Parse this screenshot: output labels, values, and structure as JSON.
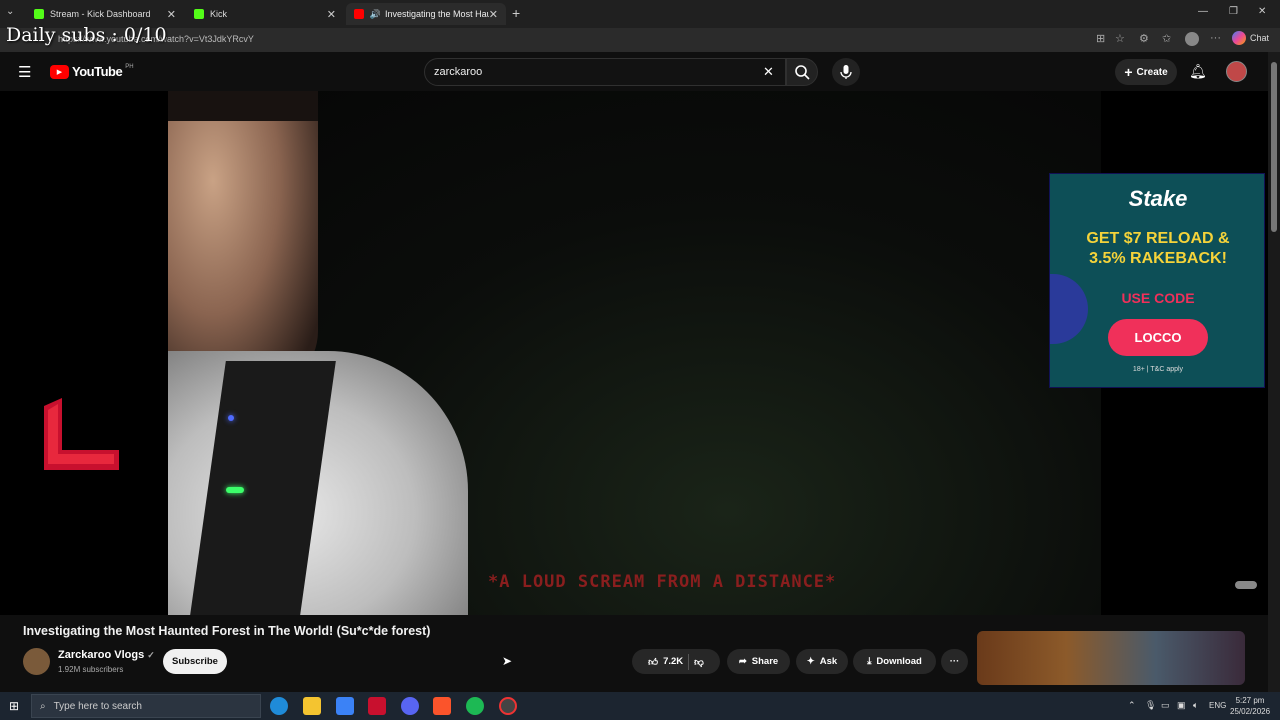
{
  "overlay": {
    "text": "Daily subs : 0/10"
  },
  "browser": {
    "tabs": [
      {
        "label": "Stream - Kick Dashboard",
        "favicon_color": "#53fc18"
      },
      {
        "label": "Kick",
        "favicon_color": "#53fc18"
      },
      {
        "label": "Investigating the Most Haunte",
        "favicon_color": "#ff0000"
      }
    ],
    "url": "https://www.youtube.com/watch?v=Vt3JdkYRcvY",
    "chat_label": "Chat"
  },
  "youtube": {
    "logo_text": "YouTube",
    "region": "PH",
    "search_value": "zarckaroo",
    "create_label": "Create"
  },
  "video": {
    "caption": "*A LOUD SCREAM FROM A DISTANCE*",
    "ad": {
      "brand": "Stake",
      "headline_line1": "GET $7 RELOAD &",
      "headline_line2": "3.5% RAKEBACK!",
      "use_code": "USE CODE",
      "code": "LOCCO",
      "disclaimer": "18+ | T&C apply"
    }
  },
  "info": {
    "title": "Investigating the Most Haunted Forest in The World! (Su*c*de forest)",
    "channel": "Zarckaroo Vlogs",
    "subscribers": "1.92M subscribers",
    "subscribe_label": "Subscribe",
    "likes": "7.2K",
    "share_label": "Share",
    "ask_label": "Ask",
    "download_label": "Download"
  },
  "taskbar": {
    "search_placeholder": "Type here to search",
    "language": "ENG",
    "time": "5:27 pm",
    "date": "25/02/2026"
  },
  "colors": {
    "youtube_red": "#ff0000",
    "accent_pink": "#f0305a"
  }
}
